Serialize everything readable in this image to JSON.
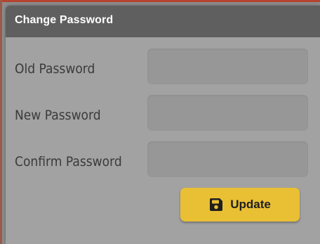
{
  "dialog": {
    "title": "Change Password"
  },
  "fields": [
    {
      "label": "Old Password",
      "value": "",
      "type": "password"
    },
    {
      "label": "New Password",
      "value": "",
      "type": "password"
    },
    {
      "label": "Confirm Password",
      "value": "",
      "type": "password"
    }
  ],
  "actions": {
    "update_label": "Update",
    "update_icon": "floppy-disk-save-icon"
  },
  "colors": {
    "header_bg": "#5f5f5f",
    "dialog_bg": "#a2a2a2",
    "input_bg": "#979797",
    "button_bg": "#e9bf34",
    "accent": "#b5432f"
  }
}
